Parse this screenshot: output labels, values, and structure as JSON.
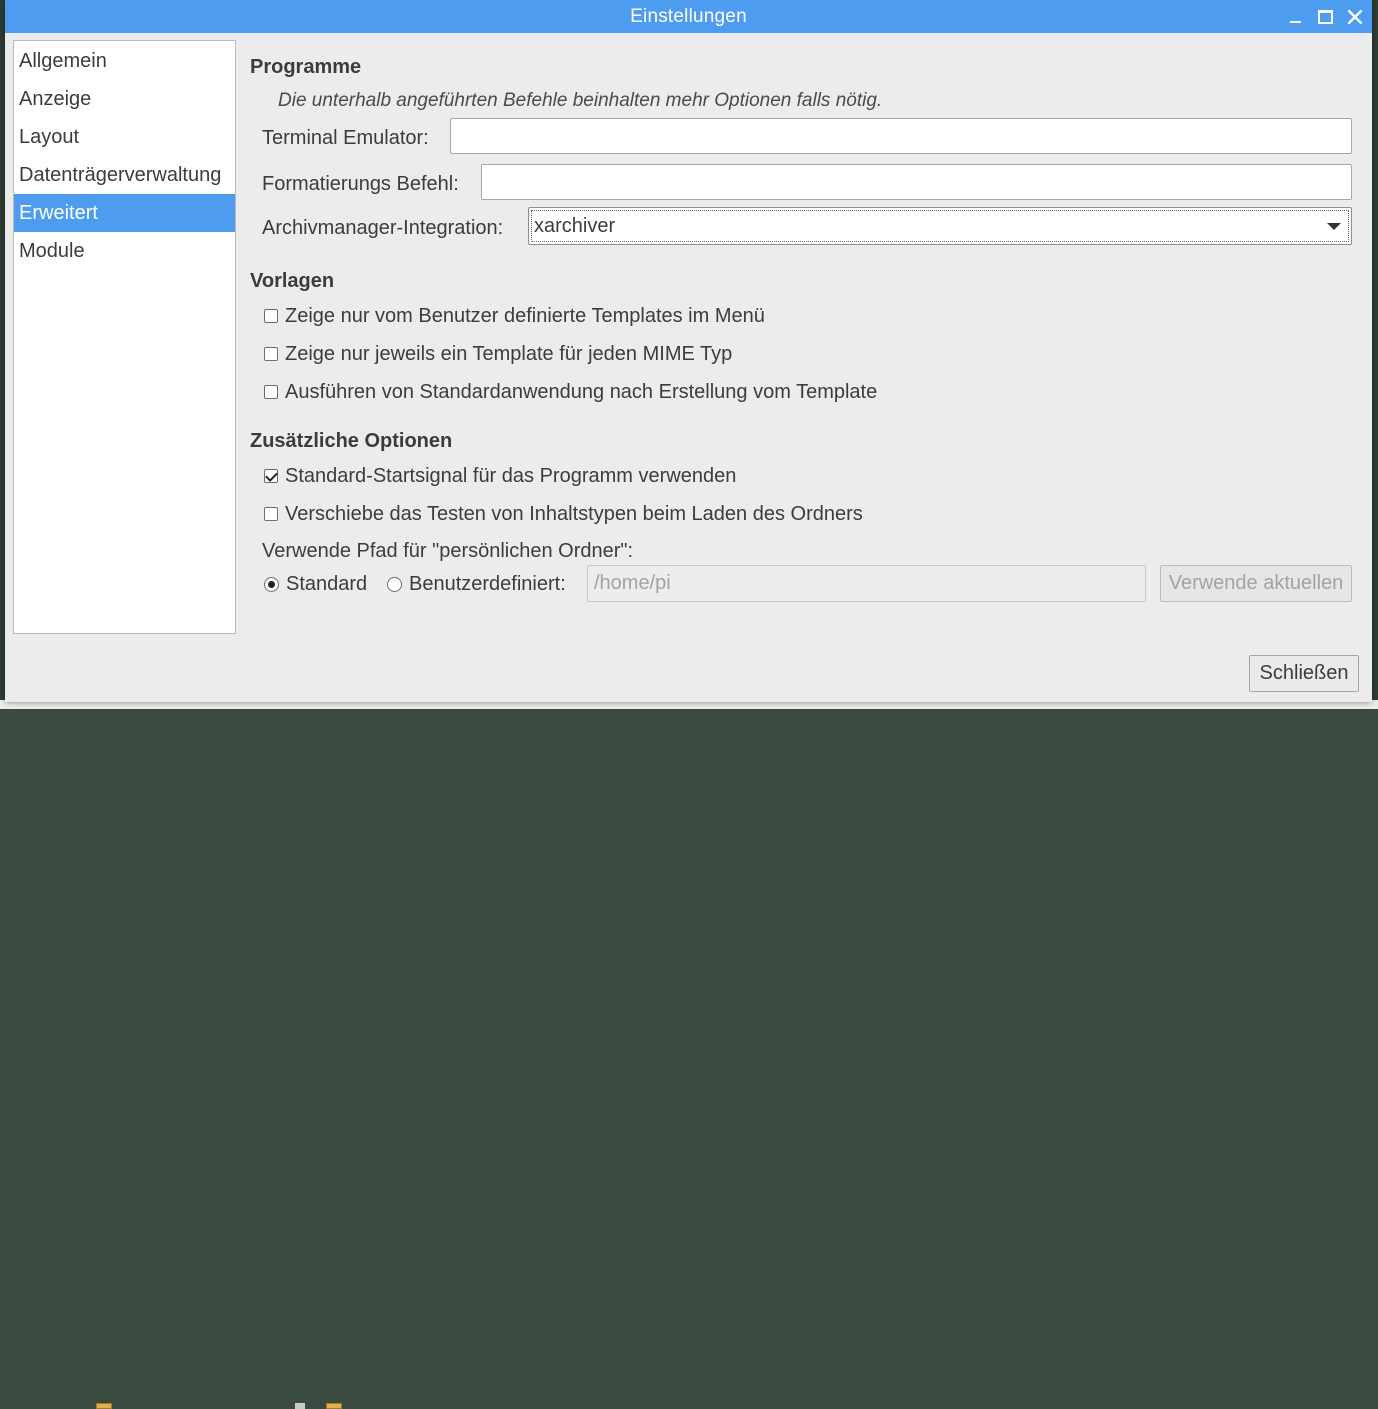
{
  "window": {
    "title": "Einstellungen"
  },
  "sidebar": {
    "items": [
      {
        "label": "Allgemein"
      },
      {
        "label": "Anzeige"
      },
      {
        "label": "Layout"
      },
      {
        "label": "Datenträgerverwaltung"
      },
      {
        "label": "Erweitert",
        "selected": true
      },
      {
        "label": "Module"
      }
    ]
  },
  "programs": {
    "heading": "Programme",
    "note": "Die unterhalb angeführten Befehle beinhalten mehr Optionen falls nötig.",
    "terminal_label": "Terminal Emulator:",
    "terminal_value": "",
    "format_label": "Formatierungs Befehl:",
    "format_value": "",
    "archiver_label": "Archivmanager-Integration:",
    "archiver_value": "xarchiver"
  },
  "templates": {
    "heading": "Vorlagen",
    "options": [
      {
        "label": "Zeige nur vom Benutzer definierte Templates im Menü",
        "checked": false
      },
      {
        "label": "Zeige nur jeweils ein Template für jeden MIME Typ",
        "checked": false
      },
      {
        "label": "Ausführen von Standardanwendung nach Erstellung vom Template",
        "checked": false
      }
    ]
  },
  "extra": {
    "heading": "Zusätzliche Optionen",
    "options": [
      {
        "label": "Standard-Startsignal für das Programm verwenden",
        "checked": true
      },
      {
        "label": "Verschiebe das Testen von Inhaltstypen beim Laden des Ordners",
        "checked": false
      }
    ],
    "home_label": "Verwende Pfad für \"persönlichen Ordner\":",
    "radio_default_label": "Standard",
    "radio_default_selected": true,
    "radio_custom_label": "Benutzerdefiniert:",
    "radio_custom_selected": false,
    "custom_path_placeholder": "/home/pi",
    "use_current_label": "Verwende aktuellen"
  },
  "footer": {
    "close_label": "Schließen"
  },
  "colors": {
    "accent": "#4e9cf0",
    "window_bg": "#ececec"
  }
}
